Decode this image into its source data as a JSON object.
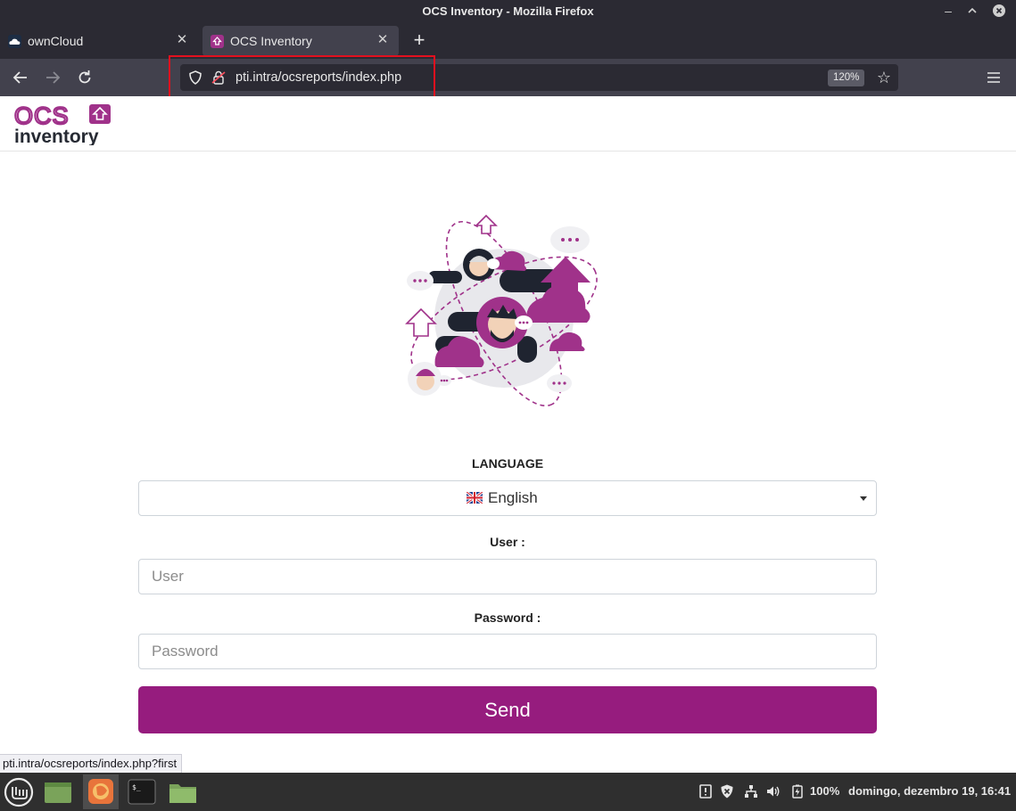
{
  "window": {
    "title": "OCS Inventory - Mozilla Firefox"
  },
  "tabs": [
    {
      "label": "ownCloud",
      "active": false,
      "favicon": "owncloud-cloud-icon"
    },
    {
      "label": "OCS Inventory",
      "active": true,
      "favicon": "ocs-inventory-icon"
    }
  ],
  "navbar": {
    "url": "pti.intra/ocsreports/index.php",
    "zoom": "120%"
  },
  "logo": {
    "text_top": "OCS",
    "text_bottom": "inventory"
  },
  "form": {
    "language_label": "LANGUAGE",
    "language_value": "English",
    "user_label": "User :",
    "user_placeholder": "User",
    "password_label": "Password :",
    "password_placeholder": "Password",
    "send_label": "Send"
  },
  "status_link": "pti.intra/ocsreports/index.php?first",
  "taskbar": {
    "battery": "100%",
    "datetime": "domingo, dezembro 19, 16:41"
  },
  "colors": {
    "accent": "#961c7e",
    "brand_purple": "#a0328a",
    "highlight_box": "#e3101e"
  }
}
